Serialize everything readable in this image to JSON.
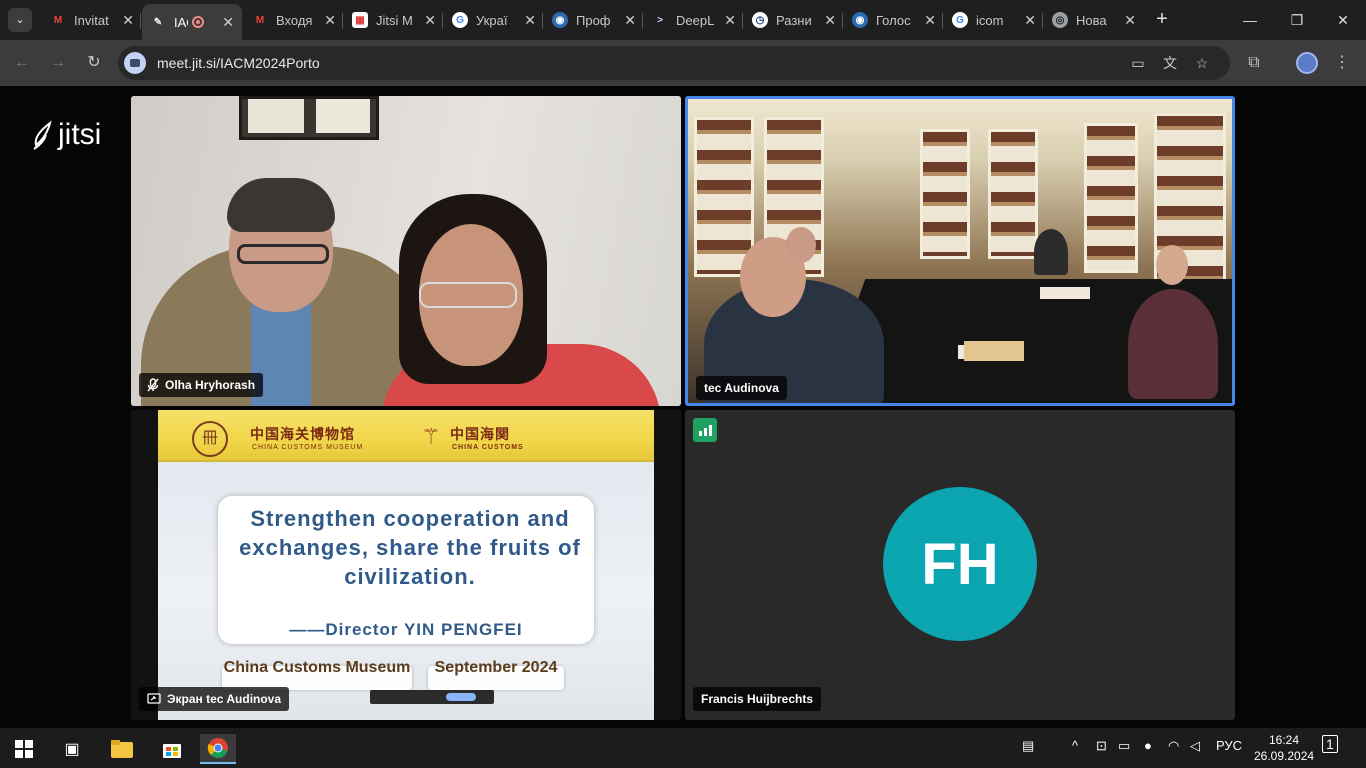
{
  "browser": {
    "tabs": [
      {
        "label": "Invitat",
        "icon": "gmail-icon",
        "active": false
      },
      {
        "label": "IAC",
        "icon": "jitsi-icon",
        "active": true
      },
      {
        "label": "Входя",
        "icon": "gmail-icon",
        "active": false
      },
      {
        "label": "Jitsi M",
        "icon": "calendar-icon",
        "active": false
      },
      {
        "label": "Украї",
        "icon": "google-icon",
        "active": false
      },
      {
        "label": "Проф",
        "icon": "globe-icon",
        "active": false
      },
      {
        "label": "DeepL",
        "icon": "deepl-icon",
        "active": false
      },
      {
        "label": "Разни",
        "icon": "clock-icon",
        "active": false
      },
      {
        "label": "Голос",
        "icon": "globe-icon",
        "active": false
      },
      {
        "label": "icom",
        "icon": "google-icon",
        "active": false
      },
      {
        "label": "Нова",
        "icon": "chrome-icon",
        "active": false
      }
    ],
    "url": "meet.jit.si/IACM2024Porto",
    "close_glyph": "✕"
  },
  "jitsi": {
    "logo_text": "jitsi",
    "participants": [
      {
        "name": "Olha Hryhorash",
        "muted": true
      },
      {
        "name": "tec Audinova",
        "active_speaker": true
      },
      {
        "name": "Экран tec Audinova",
        "screen_share": true
      },
      {
        "name": "Francis Huijbrechts",
        "initials": "FH",
        "avatar_color": "#0ba5b0"
      }
    ]
  },
  "slide": {
    "museum_cn": "中国海关博物馆",
    "museum_en": "CHINA CUSTOMS MUSEUM",
    "customs_cn": "中国海関",
    "customs_en": "CHINA CUSTOMS",
    "quote": "Strengthen cooperation and exchanges, share the fruits of civilization.",
    "author": "——Director YIN PENGFEI",
    "left_caption": "China Customs Museum",
    "right_caption": "September 2024"
  },
  "taskbar": {
    "language": "РУС",
    "time": "16:24",
    "date": "26.09.2024",
    "notifications": "1"
  },
  "colors": {
    "active_speaker_border": "#4687ed",
    "avatar": "#0ba5b0",
    "quality_indicator": "#1fa261"
  }
}
